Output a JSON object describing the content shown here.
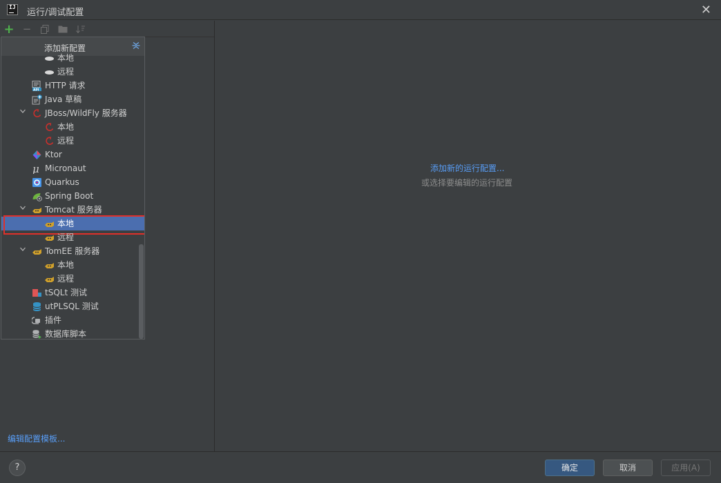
{
  "window": {
    "title": "运行/调试配置"
  },
  "toolbar": {
    "add": "+",
    "remove": "−"
  },
  "popup": {
    "header": "添加新配置",
    "items": [
      {
        "label": "本地",
        "icon": "cloud-icon",
        "level": 1
      },
      {
        "label": "远程",
        "icon": "cloud-icon",
        "level": 1
      },
      {
        "label": "HTTP 请求",
        "icon": "api-icon",
        "level": 0
      },
      {
        "label": "Java 草稿",
        "icon": "java-scratch-icon",
        "level": 0
      },
      {
        "label": "JBoss/WildFly 服务器",
        "icon": "jboss-icon",
        "level": 0,
        "expanded": true
      },
      {
        "label": "本地",
        "icon": "jboss-icon",
        "level": 1
      },
      {
        "label": "远程",
        "icon": "jboss-icon",
        "level": 1
      },
      {
        "label": "Ktor",
        "icon": "ktor-icon",
        "level": 0
      },
      {
        "label": "Micronaut",
        "icon": "micronaut-icon",
        "level": 0
      },
      {
        "label": "Quarkus",
        "icon": "quarkus-icon",
        "level": 0
      },
      {
        "label": "Spring Boot",
        "icon": "spring-boot-icon",
        "level": 0
      },
      {
        "label": "Tomcat 服务器",
        "icon": "tomcat-icon",
        "level": 0,
        "expanded": true
      },
      {
        "label": "本地",
        "icon": "tomcat-icon",
        "level": 1,
        "selected": true
      },
      {
        "label": "远程",
        "icon": "tomcat-icon",
        "level": 1
      },
      {
        "label": "TomEE 服务器",
        "icon": "tomee-icon",
        "level": 0,
        "expanded": true
      },
      {
        "label": "本地",
        "icon": "tomee-icon",
        "level": 1
      },
      {
        "label": "远程",
        "icon": "tomee-icon",
        "level": 1
      },
      {
        "label": "tSQLt 测试",
        "icon": "tsqlt-icon",
        "level": 0
      },
      {
        "label": "utPLSQL 测试",
        "icon": "database-icon",
        "level": 0
      },
      {
        "label": "插件",
        "icon": "plugin-icon",
        "level": 0
      },
      {
        "label": "数据库脚本",
        "icon": "db-script-icon",
        "level": 0
      }
    ]
  },
  "left": {
    "edit_templates": "编辑配置模板..."
  },
  "main": {
    "add_link": "添加新的运行配置...",
    "hint": "或选择要编辑的运行配置"
  },
  "footer": {
    "help": "?",
    "ok": "确定",
    "cancel": "取消",
    "apply": "应用(A)"
  },
  "colors": {
    "background": "#3c3f41",
    "selection": "#4b6eaf",
    "link": "#589df6",
    "highlight_border": "#e0302a",
    "primary_button": "#365880"
  }
}
